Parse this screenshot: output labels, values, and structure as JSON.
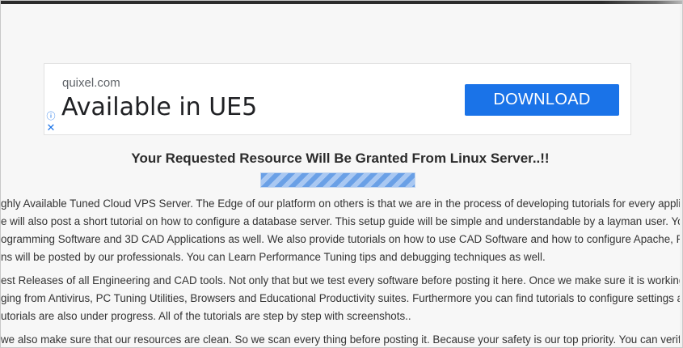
{
  "ad": {
    "domain": "quixel.com",
    "headline": "Available in UE5",
    "cta_label": "DOWNLOAD",
    "info_icon": "info-icon",
    "close_icon": "close-icon"
  },
  "page": {
    "headline": "Your Requested Resource Will Be Granted From Linux Server..!!",
    "progress_state": "indeterminate",
    "paragraphs": [
      {
        "lines": [
          "ghly Available Tuned Cloud VPS Server. The Edge of our platform on others is that we are in the process of developing tutorials for every application",
          "e will also post a short tutorial on how to configure a database server. This setup guide will be simple and understandable by a layman user. You can",
          "ogramming Software and 3D CAD Applications as well. We also provide tutorials on how to use CAD Software and how to configure Apache, PHP, M",
          "ns will be posted by our professionals. You can Learn Performance Tuning tips and debugging techniques as well."
        ]
      },
      {
        "lines": [
          "est Releases of all Engineering and CAD tools. Not only that but we test every software before posting it here. Once we make sure it is working then",
          "ging from Antivirus, PC Tuning Utilities, Browsers and Educational Productivity suites. Furthermore you can find tutorials to configure settings and le",
          "utorials are also under progress. All of the tutorials are step by step with screenshots.."
        ]
      },
      {
        "lines": [
          "we also make sure that our resources are clean. So we scan every thing before posting it. Because your safety is our top priority. You can verify from"
        ]
      }
    ]
  },
  "colors": {
    "cta": "#1a73e8",
    "page_bg": "#f7f7f7",
    "text": "#333333"
  }
}
